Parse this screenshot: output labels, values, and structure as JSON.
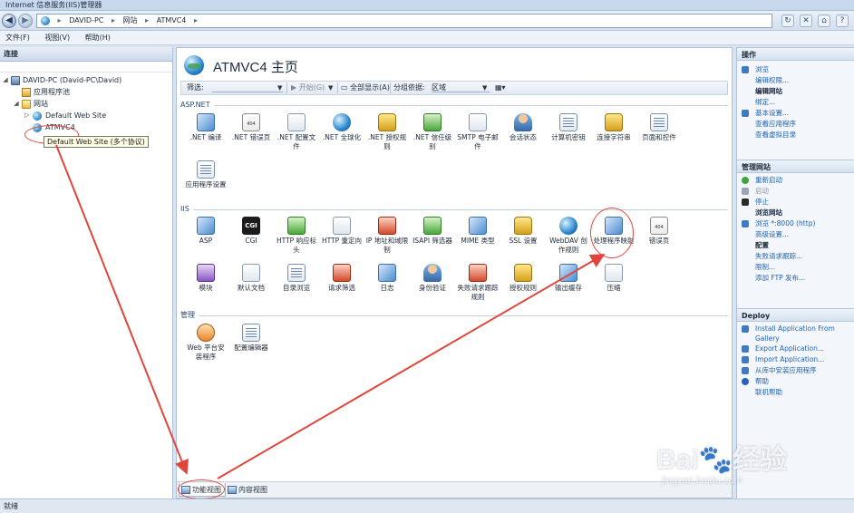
{
  "window": {
    "title": "Internet 信息服务(IIS)管理器"
  },
  "address": {
    "crumbs": [
      "DAVID-PC",
      "网站",
      "ATMVC4"
    ],
    "separator": "▸"
  },
  "menu": [
    "文件(F)",
    "视图(V)",
    "帮助(H)"
  ],
  "connections": {
    "header": "连接",
    "tree": [
      {
        "label": "DAVID-PC (David-PC\\David)",
        "icon": "server-icon",
        "toggle": "◢"
      },
      {
        "label": "应用程序池",
        "icon": "app-pool-icon",
        "toggle": ""
      },
      {
        "label": "网站",
        "icon": "folder-icon",
        "toggle": "◢"
      },
      {
        "label": "Default Web Site",
        "icon": "globe-icon",
        "toggle": "▷"
      },
      {
        "label": "ATMVC4",
        "icon": "globe-icon",
        "toggle": ""
      }
    ],
    "tooltip": "Default Web Site (多个协议)"
  },
  "main": {
    "title": "ATMVC4 主页",
    "filter": {
      "label": "筛选:",
      "start": "开始(G)",
      "show_all": "全部显示(A)",
      "group_by_label": "分组依据:",
      "group_by_value": "区域"
    },
    "groups": {
      "aspnet": {
        "name": "ASP.NET",
        "items": [
          {
            "label": ".NET 编译",
            "icon": "dotnet-compile-icon",
            "style": "blue"
          },
          {
            "label": ".NET 错误页",
            "icon": "error-page-icon",
            "style": "err"
          },
          {
            "label": ".NET 配置文件",
            "icon": "profile-icon",
            "style": "doc"
          },
          {
            "label": ".NET 全球化",
            "icon": "globalization-icon",
            "style": "globe"
          },
          {
            "label": ".NET 授权规则",
            "icon": "authorization-icon",
            "style": "lock"
          },
          {
            "label": ".NET 信任级别",
            "icon": "trust-level-icon",
            "style": "green"
          },
          {
            "label": "SMTP 电子邮件",
            "icon": "smtp-icon",
            "style": "doc"
          },
          {
            "label": "会话状态",
            "icon": "session-state-icon",
            "style": "person"
          },
          {
            "label": "计算机密钥",
            "icon": "machine-key-icon",
            "style": "grid"
          },
          {
            "label": "连接字符串",
            "icon": "connection-string-icon",
            "style": "lock"
          },
          {
            "label": "页面和控件",
            "icon": "pages-controls-icon",
            "style": "grid"
          },
          {
            "label": "应用程序设置",
            "icon": "app-settings-icon",
            "style": "grid"
          }
        ]
      },
      "iis": {
        "name": "IIS",
        "items": [
          {
            "label": "ASP",
            "icon": "asp-icon",
            "style": "blue"
          },
          {
            "label": "CGI",
            "icon": "cgi-icon",
            "style": "dark",
            "glyph": "CGI"
          },
          {
            "label": "HTTP 响应标头",
            "icon": "http-headers-icon",
            "style": "green"
          },
          {
            "label": "HTTP 重定向",
            "icon": "redirect-icon",
            "style": "doc"
          },
          {
            "label": "IP 地址和域限制",
            "icon": "ip-restrictions-icon",
            "style": "red"
          },
          {
            "label": "ISAPI 筛选器",
            "icon": "isapi-filter-icon",
            "style": "green"
          },
          {
            "label": "MIME 类型",
            "icon": "mime-icon",
            "style": "blue"
          },
          {
            "label": "SSL 设置",
            "icon": "ssl-lock-icon",
            "style": "lock"
          },
          {
            "label": "WebDAV 创作规则",
            "icon": "webdav-icon",
            "style": "globe"
          },
          {
            "label": "处理程序映射",
            "icon": "handler-mappings-icon",
            "style": "blue"
          },
          {
            "label": "错误页",
            "icon": "error-page-icon",
            "style": "err"
          },
          {
            "label": "模块",
            "icon": "modules-icon",
            "style": "purple"
          },
          {
            "label": "默认文档",
            "icon": "default-document-icon",
            "style": "doc"
          },
          {
            "label": "目录浏览",
            "icon": "directory-browsing-icon",
            "style": "grid"
          },
          {
            "label": "请求筛选",
            "icon": "request-filtering-icon",
            "style": "red"
          },
          {
            "label": "日志",
            "icon": "logging-icon",
            "style": "blue"
          },
          {
            "label": "身份验证",
            "icon": "authentication-icon",
            "style": "person"
          },
          {
            "label": "失败请求跟踪规则",
            "icon": "failed-request-icon",
            "style": "red"
          },
          {
            "label": "授权规则",
            "icon": "authorization-rules-icon",
            "style": "lock"
          },
          {
            "label": "输出缓存",
            "icon": "output-cache-icon",
            "style": "blue"
          },
          {
            "label": "压缩",
            "icon": "compression-icon",
            "style": "doc"
          }
        ]
      },
      "management": {
        "name": "管理",
        "items": [
          {
            "label": "Web 平台安装程序",
            "icon": "web-platform-installer-icon",
            "style": "orange"
          },
          {
            "label": "配置编辑器",
            "icon": "configuration-editor-icon",
            "style": "grid"
          }
        ]
      }
    },
    "tabs": {
      "features": "功能视图",
      "content": "内容视图"
    }
  },
  "actions": {
    "header": "操作",
    "top": [
      {
        "label": "浏览",
        "kind": "link",
        "icon": "b"
      },
      {
        "label": "编辑权限...",
        "kind": "link",
        "icon": ""
      },
      {
        "label": "编辑网站",
        "kind": "sub",
        "icon": ""
      },
      {
        "label": "绑定...",
        "kind": "link",
        "icon": ""
      },
      {
        "label": "基本设置...",
        "kind": "link",
        "icon": "b"
      },
      {
        "label": "查看应用程序",
        "kind": "link",
        "icon": ""
      },
      {
        "label": "查看虚拟目录",
        "kind": "link",
        "icon": ""
      }
    ],
    "manage": {
      "header": "管理网站",
      "items": [
        {
          "label": "重新启动",
          "kind": "link",
          "icon": "g"
        },
        {
          "label": "启动",
          "kind": "dis",
          "icon": "gr"
        },
        {
          "label": "停止",
          "kind": "link",
          "icon": "k"
        },
        {
          "label": "浏览网站",
          "kind": "sub",
          "icon": ""
        },
        {
          "label": "浏览 *:8000 (http)",
          "kind": "link",
          "icon": "b"
        },
        {
          "label": "高级设置...",
          "kind": "link",
          "icon": ""
        },
        {
          "label": "配置",
          "kind": "sub",
          "icon": ""
        },
        {
          "label": "失败请求跟踪...",
          "kind": "link",
          "icon": ""
        },
        {
          "label": "限制...",
          "kind": "link",
          "icon": ""
        },
        {
          "label": "添加 FTP 发布...",
          "kind": "link",
          "icon": ""
        }
      ]
    },
    "deploy": {
      "header": "Deploy",
      "items": [
        {
          "label": "Install Application From Gallery",
          "kind": "wrap",
          "icon": "b"
        },
        {
          "label": "Export Application...",
          "kind": "link",
          "icon": "b"
        },
        {
          "label": "Import Application...",
          "kind": "link",
          "icon": "b"
        },
        {
          "label": "从库中安装应用程序",
          "kind": "link",
          "icon": "b"
        },
        {
          "label": "帮助",
          "kind": "link",
          "icon": "q"
        },
        {
          "label": "联机帮助",
          "kind": "link",
          "icon": ""
        }
      ]
    }
  },
  "status": {
    "text": "就绪"
  },
  "watermark": {
    "main": "Bai🐾经验",
    "sub": "jingyan.baidu.com"
  },
  "colors": {
    "annotation": "#e0463c",
    "link": "#1e63b8"
  }
}
